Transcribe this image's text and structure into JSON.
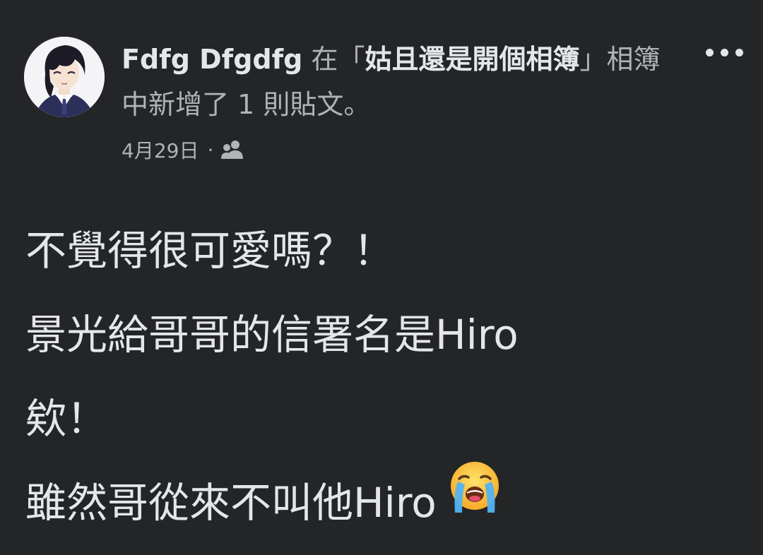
{
  "post": {
    "author": "Fdfg Dfgdfg",
    "action_prefix": " 在「",
    "album_name": "姑且還是開個相簿",
    "action_suffix": "」相簿中新增了 1 則貼文。",
    "date": "4月29日",
    "separator": "·",
    "privacy_icon": "friends-icon",
    "more_icon": "more-options-icon",
    "content_lines": [
      "不覺得很可愛嗎？！",
      "景光給哥哥的信署名是Hiro",
      "欸！",
      "雖然哥從來不叫他Hiro"
    ],
    "emoji": "loudly-crying-face"
  },
  "colors": {
    "background": "#242526",
    "primary_text": "#e4e6eb",
    "secondary_text": "#b0b3b8"
  }
}
